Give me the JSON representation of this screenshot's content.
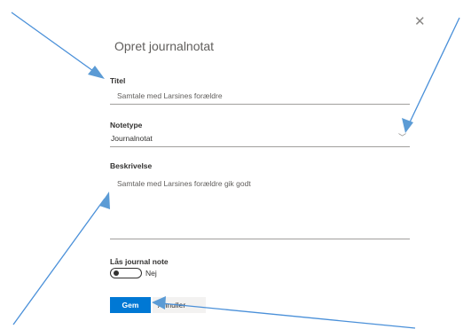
{
  "dialog": {
    "title": "Opret journalnotat",
    "close_icon": "close-icon"
  },
  "form": {
    "title_label": "Titel",
    "title_value": "Samtale med Larsines forældre",
    "type_label": "Notetype",
    "type_value": "Journalnotat",
    "description_label": "Beskrivelse",
    "description_value": "Samtale med Larsines forældre gik godt",
    "lock_label": "Lås journal note",
    "lock_state": "Nej"
  },
  "buttons": {
    "save": "Gem",
    "cancel": "Annuller"
  },
  "colors": {
    "primary": "#0078d4",
    "arrow": "#4a90d9"
  }
}
